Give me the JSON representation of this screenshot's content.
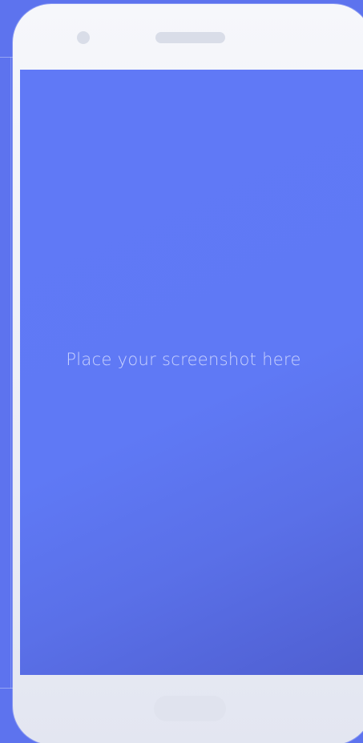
{
  "screen": {
    "placeholder_text": "Place your screenshot here"
  },
  "colors": {
    "background": "#5d73ee",
    "phone_body": "#eceef6",
    "screen_accent": "#6079f6"
  },
  "icons": {
    "camera": "front-camera-icon",
    "speaker": "earpiece-speaker-icon",
    "home": "home-button-icon"
  }
}
